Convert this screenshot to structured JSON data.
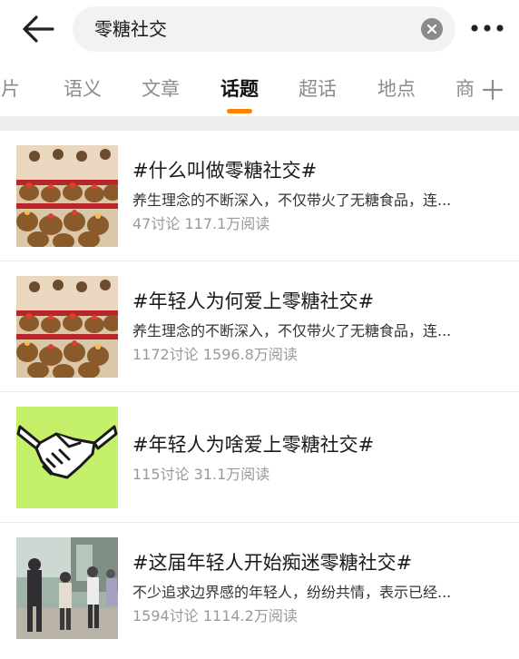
{
  "search": {
    "query": "零糖社交"
  },
  "tabs": [
    {
      "label": "图片"
    },
    {
      "label": "语义"
    },
    {
      "label": "文章"
    },
    {
      "label": "话题"
    },
    {
      "label": "超话"
    },
    {
      "label": "地点"
    },
    {
      "label": "商"
    }
  ],
  "topics": [
    {
      "title": "#什么叫做零糖社交#",
      "desc": "养生理念的不断深入，不仅带火了无糖食品，连...",
      "discussions": "47讨论",
      "reads": "117.1万阅读",
      "thumb_icon": "capybara-plush-icon"
    },
    {
      "title": "#年轻人为何爱上零糖社交#",
      "desc": "养生理念的不断深入，不仅带火了无糖食品，连...",
      "discussions": "1172讨论",
      "reads": "1596.8万阅读",
      "thumb_icon": "capybara-plush-icon"
    },
    {
      "title": "#年轻人为啥爱上零糖社交#",
      "desc": "",
      "discussions": "115讨论",
      "reads": "31.1万阅读",
      "thumb_icon": "handshake-icon"
    },
    {
      "title": "#这届年轻人开始痴迷零糖社交#",
      "desc": "不少追求边界感的年轻人，纷纷共情，表示已经...",
      "discussions": "1594讨论",
      "reads": "1114.2万阅读",
      "thumb_icon": "people-photo-icon"
    }
  ],
  "colors": {
    "accent": "#ff8200",
    "muted": "#999999",
    "handshake_bg": "#c5f06a"
  }
}
